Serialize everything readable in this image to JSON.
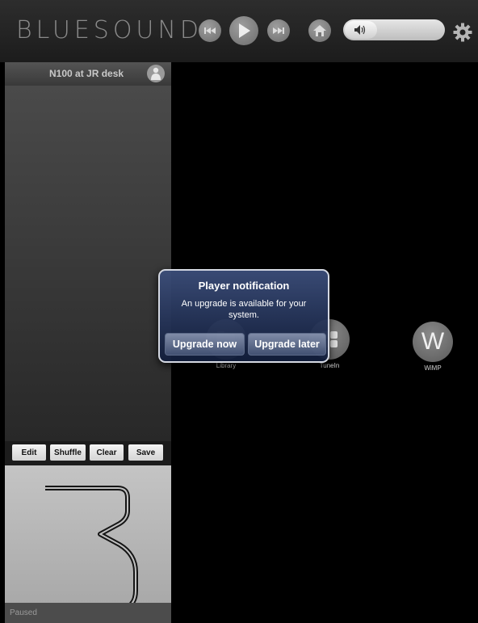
{
  "app": {
    "logo_text": "BLUESOUND",
    "logo_reg": "®"
  },
  "toolbar": {
    "icons": [
      "previous-icon",
      "play-icon",
      "next-icon",
      "home-icon",
      "speaker-icon",
      "gear-icon"
    ],
    "volume_level": 0.3
  },
  "zone": {
    "name": "N100 at JR desk"
  },
  "queue": {
    "edit_label": "Edit",
    "shuffle_label": "Shuffle",
    "clear_label": "Clear",
    "save_label": "Save"
  },
  "player": {
    "status": "Paused"
  },
  "sources": [
    {
      "label": "Library"
    },
    {
      "label": "TuneIn"
    },
    {
      "label": "WiMP",
      "glyph": "W"
    }
  ],
  "dialog": {
    "title": "Player notification",
    "message": "An upgrade is available for your system.",
    "upgrade_now": "Upgrade now",
    "upgrade_later": "Upgrade later"
  }
}
